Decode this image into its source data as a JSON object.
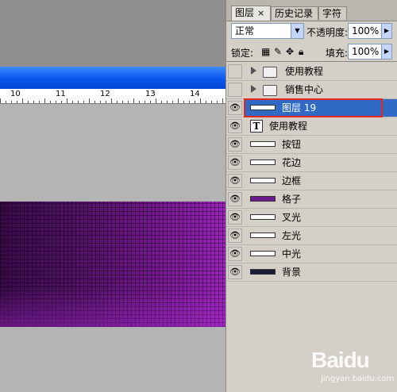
{
  "ruler": {
    "labels": [
      "10",
      "11",
      "12",
      "13",
      "14"
    ]
  },
  "panel": {
    "tabs": [
      {
        "label": "图层",
        "close": "×"
      },
      {
        "label": "历史记录"
      },
      {
        "label": "字符"
      }
    ],
    "blend_mode": "正常",
    "opacity_label": "不透明度:",
    "opacity_value": "100%",
    "lock_label": "锁定:",
    "fill_label": "填充:",
    "fill_value": "100%",
    "layers": [
      {
        "name": "使用教程",
        "kind": "folder",
        "visible": false
      },
      {
        "name": "销售中心",
        "kind": "folder",
        "visible": false
      },
      {
        "name": "图层 19",
        "kind": "layer",
        "visible": true,
        "selected": true
      },
      {
        "name": "使用教程",
        "kind": "text",
        "visible": true
      },
      {
        "name": "按钮",
        "kind": "layer",
        "visible": true
      },
      {
        "name": "花边",
        "kind": "layer",
        "visible": true
      },
      {
        "name": "边框",
        "kind": "layer",
        "visible": true
      },
      {
        "name": "格子",
        "kind": "layer",
        "visible": true
      },
      {
        "name": "叉光",
        "kind": "layer",
        "visible": true
      },
      {
        "name": "左光",
        "kind": "layer",
        "visible": true
      },
      {
        "name": "中光",
        "kind": "layer",
        "visible": true
      },
      {
        "name": "背景",
        "kind": "layer",
        "visible": true
      }
    ]
  },
  "watermark": {
    "logo": "Baidu",
    "sub": "jingyan.baidu.com"
  },
  "colors": {
    "highlight": "#e8261e",
    "selection": "#316ac5",
    "pattern": "#6a1a8a"
  }
}
